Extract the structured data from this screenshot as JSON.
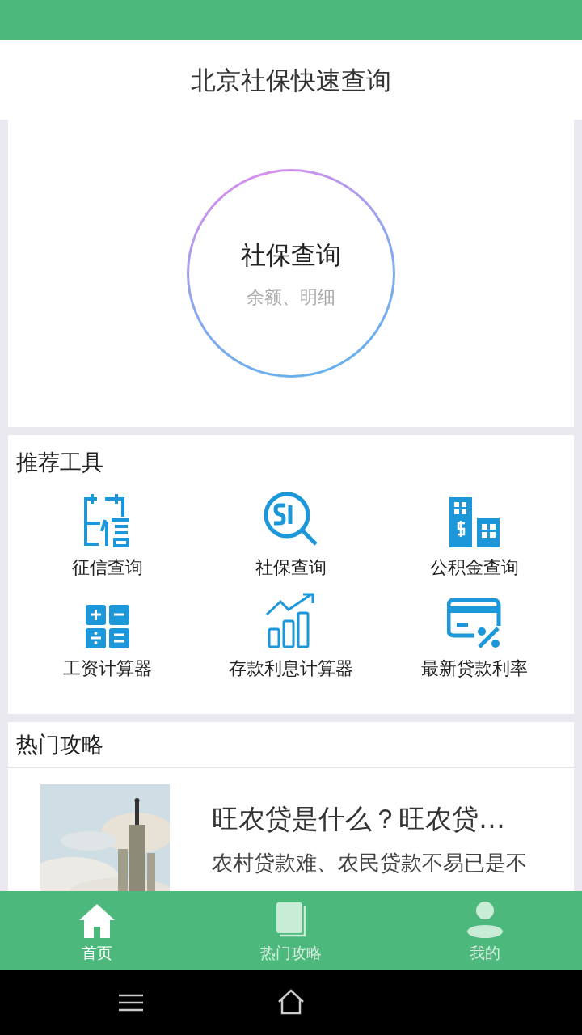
{
  "title": "北京社保快速查询",
  "hero": {
    "title": "社保查询",
    "subtitle": "余额、明细"
  },
  "tools": {
    "heading": "推荐工具",
    "items": [
      {
        "kind": "credit",
        "label": "征信查询"
      },
      {
        "kind": "si",
        "label": "社保查询"
      },
      {
        "kind": "fund",
        "label": "公积金查询"
      },
      {
        "kind": "calculator",
        "label": "工资计算器"
      },
      {
        "kind": "growth",
        "label": "存款利息计算器"
      },
      {
        "kind": "card",
        "label": "最新贷款利率"
      }
    ]
  },
  "articles": {
    "heading": "热门攻略",
    "items": [
      {
        "title": "旺农贷是什么？旺农贷…",
        "summary": "农村贷款难、农民贷款不易已是不"
      }
    ]
  },
  "tabs": [
    {
      "kind": "home",
      "label": "首页",
      "selected": true
    },
    {
      "kind": "book",
      "label": "热门攻略",
      "selected": false
    },
    {
      "kind": "user",
      "label": "我的",
      "selected": false
    }
  ]
}
